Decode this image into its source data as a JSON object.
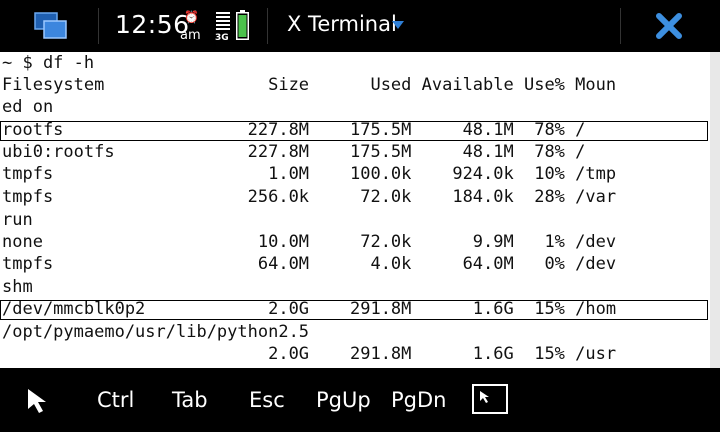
{
  "statusbar": {
    "time": "12:56",
    "ampm": "am",
    "network": "3G",
    "app_title": "X Terminal"
  },
  "terminal": {
    "lines": [
      "~ $ df -h",
      "Filesystem                Size      Used Available Use% Moun",
      "ed on",
      "rootfs                  227.8M    175.5M     48.1M  78% /",
      "ubi0:rootfs             227.8M    175.5M     48.1M  78% /",
      "tmpfs                     1.0M    100.0k    924.0k  10% /tmp",
      "tmpfs                   256.0k     72.0k    184.0k  28% /var",
      "run",
      "none                     10.0M     72.0k      9.9M   1% /dev",
      "tmpfs                    64.0M      4.0k     64.0M   0% /dev",
      "shm",
      "/dev/mmcblk0p2            2.0G    291.8M      1.6G  15% /hom",
      "/opt/pymaemo/usr/lib/python2.5",
      "                          2.0G    291.8M      1.6G  15% /usr"
    ]
  },
  "toolbar": {
    "keys": [
      "Ctrl",
      "Tab",
      "Esc",
      "PgUp",
      "PgDn"
    ]
  },
  "icons": {
    "task_switcher": "task-switcher-icon",
    "close": "close-icon",
    "pointer": "pointer-icon",
    "menu_key": "menu-key-icon"
  },
  "colors": {
    "accent": "#2f7fd6",
    "close": "#3d8fe0"
  }
}
